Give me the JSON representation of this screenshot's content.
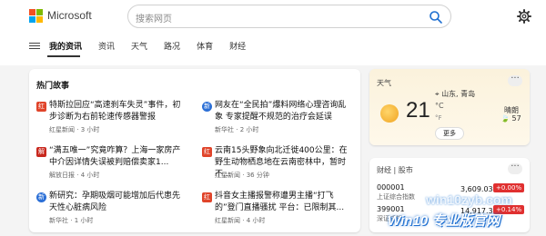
{
  "header": {
    "logo_text": "Microsoft",
    "search_placeholder": "搜索网页"
  },
  "nav": {
    "items": [
      "我的资讯",
      "资讯",
      "天气",
      "路况",
      "体育",
      "财经"
    ]
  },
  "hot_stories": {
    "title": "热门故事",
    "items": [
      {
        "headline": "特斯拉回应“高速刹车失灵”事件，初步诊断为右前轮速传感器警报",
        "source": "红星新闻",
        "time": "3 小时",
        "icon": "hongxing-news-icon",
        "icon_color": "#e0442a"
      },
      {
        "headline": "网友在“全民拍”爆料网络心理咨询乱象 专家提醒不规范的治疗会延误",
        "source": "新华社",
        "time": "2 小时",
        "icon": "xinhua-icon",
        "icon_color": "#2b6fd6"
      },
      {
        "headline": "“满五唯一”究竟咋算？上海一家房产中介因详情失误被判赔偿卖家1...",
        "source": "解放日报",
        "time": "4 小时",
        "icon": "jiefang-daily-icon",
        "icon_color": "#c8281e"
      },
      {
        "headline": "云南15头野象向北迁徙400公里：在野生动物栖息地在云南密林中，暂时不...",
        "source": "红星新闻",
        "time": "36 分钟",
        "icon": "hongxing-news-icon",
        "icon_color": "#e0442a"
      },
      {
        "headline": "新研究：孕期吸烟可能增加后代患先天性心脏病风险",
        "source": "新华社",
        "time": "1 小时",
        "icon": "xinhua-icon",
        "icon_color": "#2b6fd6"
      },
      {
        "headline": "抖音女主播报警称遭男主播“打飞的”登门直播骚扰 平台：已限制其...",
        "source": "红星新闻",
        "time": "4 小时",
        "icon": "hongxing-news-icon",
        "icon_color": "#e0442a"
      }
    ]
  },
  "weather": {
    "label": "天气",
    "location": "山东, 青岛",
    "temp": "21",
    "unit_c": "°C",
    "unit_f": "°F",
    "desc": "晴朗",
    "extra": "57",
    "more": "更多"
  },
  "stocks": {
    "label": "财经 | 股市",
    "rows": [
      {
        "code": "000001",
        "name": "上证综合指数",
        "value": "3,609.03",
        "pct": "+0.00%"
      },
      {
        "code": "399001",
        "name": "深证成指",
        "value": "14,917.39",
        "pct": "+0.14%"
      }
    ]
  },
  "watermark": {
    "site": "win10zyb.com",
    "brand": "Win10 专业版官网"
  },
  "colors": {
    "accent": "#2b6fd6",
    "stock_up": "#e03030"
  }
}
